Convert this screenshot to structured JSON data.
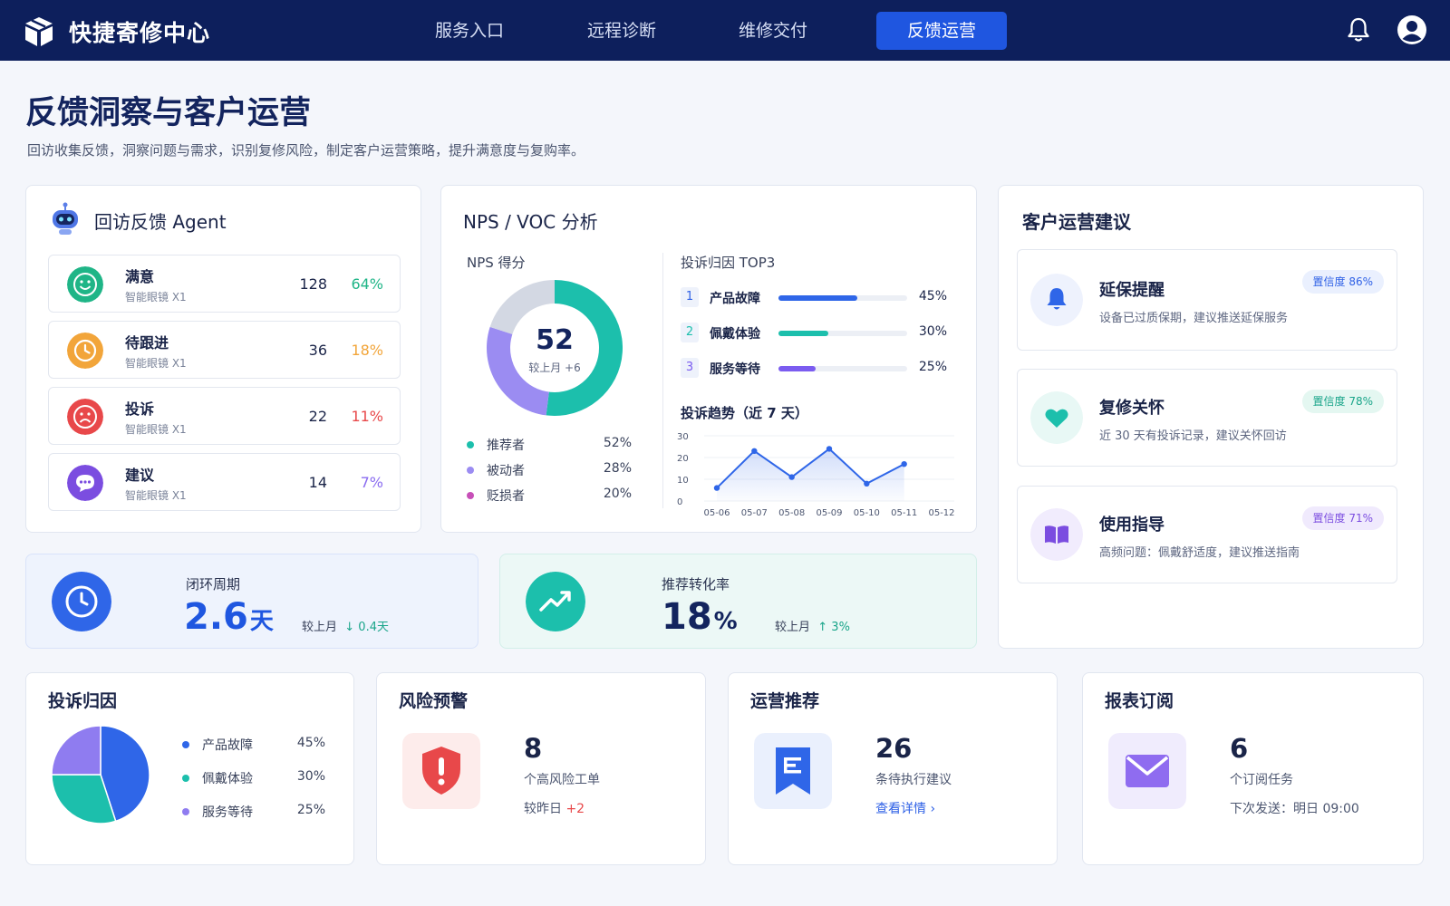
{
  "header": {
    "brand": "快捷寄修中心",
    "nav": [
      "服务入口",
      "远程诊断",
      "维修交付",
      "反馈运营"
    ],
    "active_index": 3
  },
  "page": {
    "title": "反馈洞察与客户运营",
    "subtitle": "回访收集反馈，洞察问题与需求，识别复修风险，制定客户运营策略，提升满意度与复购率。"
  },
  "agent": {
    "title": "回访反馈 Agent",
    "items": [
      {
        "label": "满意",
        "sub": "智能眼镜 X1",
        "count": "128",
        "pct": "64%",
        "icon": "smile-icon",
        "color": "#1fb587",
        "pct_color": "#1fb587"
      },
      {
        "label": "待跟进",
        "sub": "智能眼镜 X1",
        "count": "36",
        "pct": "18%",
        "icon": "clock-icon",
        "color": "#f2a53a",
        "pct_color": "#f2a53a"
      },
      {
        "label": "投诉",
        "sub": "智能眼镜 X1",
        "count": "22",
        "pct": "11%",
        "icon": "frown-icon",
        "color": "#e8484a",
        "pct_color": "#e8484a"
      },
      {
        "label": "建议",
        "sub": "智能眼镜 X1",
        "count": "14",
        "pct": "7%",
        "icon": "chat-icon",
        "color": "#7b4de0",
        "pct_color": "#8a6cf0"
      }
    ]
  },
  "nps": {
    "title": "NPS / VOC 分析",
    "score_label": "NPS 得分",
    "score": "52",
    "score_change": "较上月 +6",
    "legend": [
      {
        "label": "推荐者",
        "value": "52%",
        "color": "#1cbfac"
      },
      {
        "label": "被动者",
        "value": "28%",
        "color": "#9b8cf2"
      },
      {
        "label": "贬损者",
        "value": "20%",
        "color": "#c74fb8"
      }
    ],
    "ring_colors": [
      "#1cbfac",
      "#9b8cf2",
      "#d3d8e3"
    ],
    "top3_title": "投诉归因 TOP3",
    "top3": [
      {
        "rank": "1",
        "label": "产品故障",
        "value": "45%",
        "pct": 0.61,
        "color": "#2f66e8"
      },
      {
        "rank": "2",
        "label": "佩戴体验",
        "value": "30%",
        "pct": 0.39,
        "color": "#1cbfac"
      },
      {
        "rank": "3",
        "label": "服务等待",
        "value": "25%",
        "pct": 0.29,
        "color": "#7b5cf0"
      }
    ],
    "trend_title": "投诉趋势（近 7 天）"
  },
  "chart_data": {
    "type": "area",
    "title": "投诉趋势（近 7 天）",
    "x": [
      "05-06",
      "05-07",
      "05-08",
      "05-09",
      "05-10",
      "05-11",
      "05-12"
    ],
    "values": [
      6,
      23,
      11,
      24,
      8,
      17
    ],
    "yticks": [
      "0",
      "10",
      "20",
      "30"
    ],
    "ylim": [
      0,
      30
    ],
    "color": "#2f66e8"
  },
  "kpi": {
    "cycle": {
      "label": "闭环周期",
      "value": "2.6",
      "unit": "天",
      "cmp": "较上月",
      "delta": "↓ 0.4天"
    },
    "conversion": {
      "label": "推荐转化率",
      "value": "18",
      "unit": "%",
      "cmp": "较上月",
      "delta": "↑ 3%"
    }
  },
  "suggestions": {
    "title": "客户运营建议",
    "items": [
      {
        "title": "延保提醒",
        "desc": "设备已过质保期，建议推送延保服务",
        "badge": "置信度 86%",
        "icon": "bell-icon"
      },
      {
        "title": "复修关怀",
        "desc": "近 30 天有投诉记录，建议关怀回访",
        "badge": "置信度 78%",
        "icon": "heart-icon"
      },
      {
        "title": "使用指导",
        "desc": "高频问题：佩戴舒适度，建议推送指南",
        "badge": "置信度 71%",
        "icon": "book-icon"
      }
    ]
  },
  "complaint_cause": {
    "title": "投诉归因",
    "items": [
      {
        "label": "产品故障",
        "value": "45%",
        "color": "#2f66e8"
      },
      {
        "label": "佩戴体验",
        "value": "30%",
        "color": "#1cbfac"
      },
      {
        "label": "服务等待",
        "value": "25%",
        "color": "#8f7cf0"
      }
    ]
  },
  "risk": {
    "title": "风险预警",
    "value": "8",
    "desc": "个高风险工单",
    "cmp": "较昨日",
    "delta": "+2"
  },
  "ops": {
    "title": "运营推荐",
    "value": "26",
    "desc": "条待执行建议",
    "link": "查看详情 ›"
  },
  "report": {
    "title": "报表订阅",
    "value": "6",
    "desc": "个订阅任务",
    "next": "下次发送：明日 09:00"
  }
}
